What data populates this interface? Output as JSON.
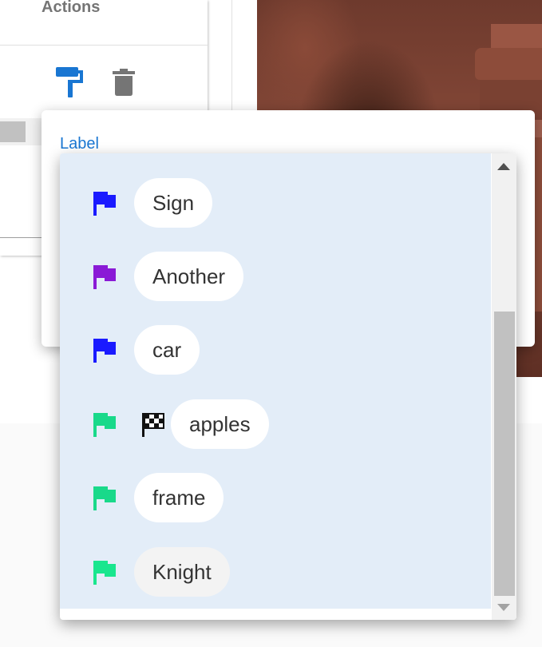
{
  "table": {
    "actions_header": "Actions",
    "action_icons": [
      "paint-roller-icon",
      "trash-icon"
    ]
  },
  "dialog": {
    "label_field": {
      "label": "Label"
    }
  },
  "dropdown": {
    "options": [
      {
        "flag_color": "#1a1aff",
        "name": "Sign"
      },
      {
        "flag_color": "#8a1ad6",
        "name": "Another"
      },
      {
        "flag_color": "#1a1aff",
        "name": "car"
      },
      {
        "flag_color": "#19d98a",
        "name": "apples",
        "icon": "checkered-flag-icon"
      },
      {
        "flag_color": "#19d98a",
        "name": "frame"
      },
      {
        "flag_color": "#19e68e",
        "name": "Knight"
      }
    ]
  },
  "colors": {
    "accent": "#1976d2",
    "dropdown_bg": "#e3edf8"
  }
}
